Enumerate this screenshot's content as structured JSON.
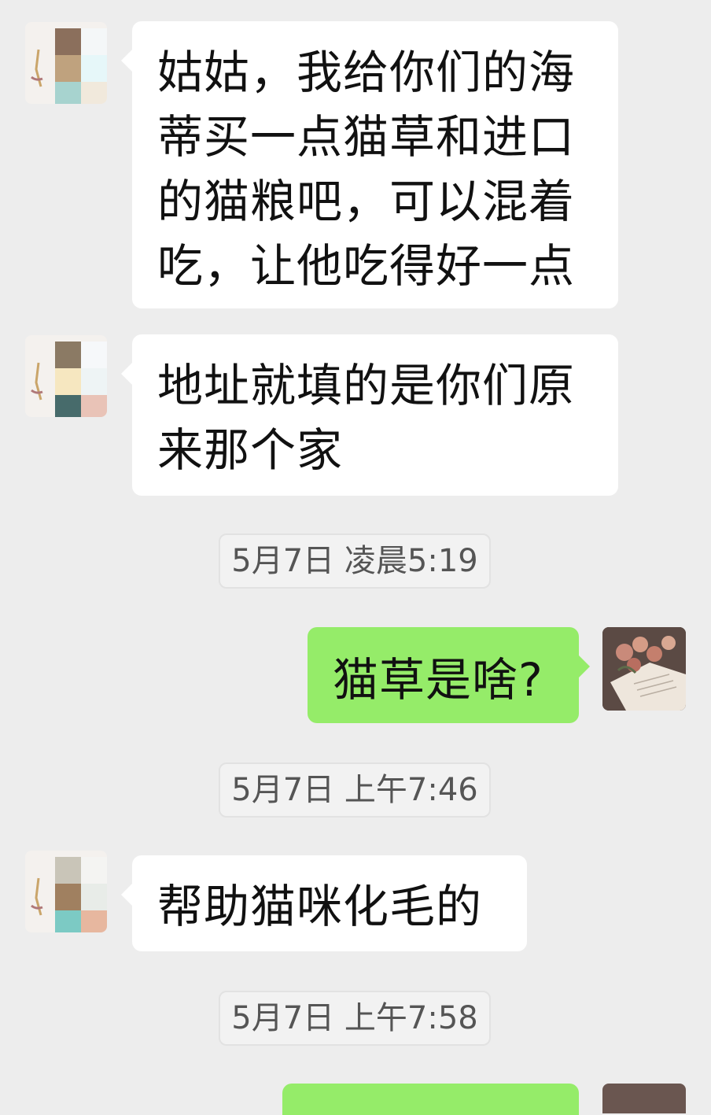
{
  "messages": [
    {
      "side": "received",
      "text": "姑姑，我给你们的海蒂买一点猫草和进口的猫粮吧，可以混着吃，让他吃得好一点"
    },
    {
      "side": "received",
      "text": "地址就填的是你们原来那个家"
    },
    {
      "side": "sent",
      "text": "猫草是啥?"
    },
    {
      "side": "received",
      "text": "帮助猫咪化毛的"
    }
  ],
  "timestamps": [
    "5月7日 凌晨5:19",
    "5月7日 上午7:46",
    "5月7日 上午7:58"
  ],
  "colors": {
    "background": "#ededed",
    "received_bubble": "#ffffff",
    "sent_bubble": "#95ec69"
  },
  "icons": {
    "contact_avatar": "pixelated-avatar-icon",
    "self_avatar": "rose-book-avatar-icon"
  }
}
